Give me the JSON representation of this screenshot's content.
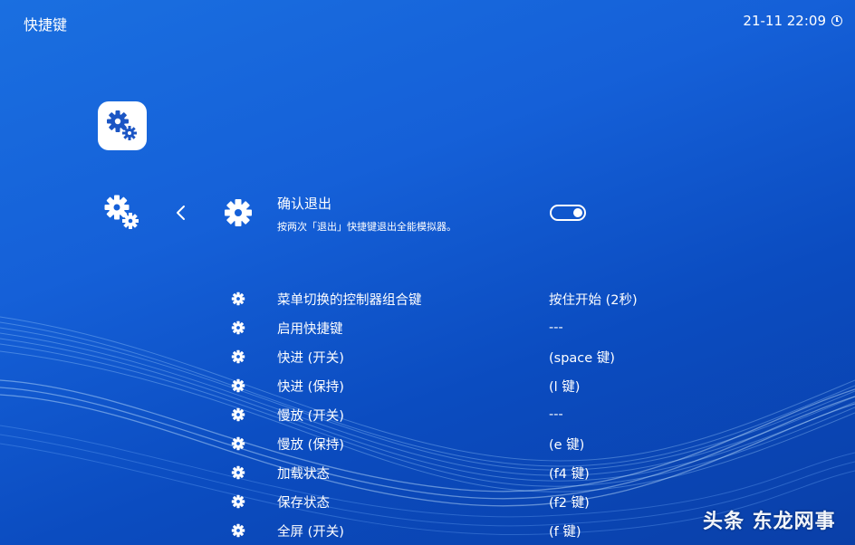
{
  "header": {
    "title": "快捷键",
    "clock": "21-11 22:09"
  },
  "highlight": {
    "title": "确认退出",
    "description": "按两次「退出」快捷键退出全能模拟器。",
    "toggle_on": true
  },
  "items": [
    {
      "label": "菜单切换的控制器组合键",
      "value": "按住开始 (2秒)"
    },
    {
      "label": "启用快捷键",
      "value": "---"
    },
    {
      "label": "快进 (开关)",
      "value": "(space 键)"
    },
    {
      "label": "快进 (保持)",
      "value": "(l 键)"
    },
    {
      "label": "慢放 (开关)",
      "value": "---"
    },
    {
      "label": "慢放 (保持)",
      "value": "(e 键)"
    },
    {
      "label": "加载状态",
      "value": "(f4 键)"
    },
    {
      "label": "保存状态",
      "value": "(f2 键)"
    },
    {
      "label": "全屏 (开关)",
      "value": "(f 键)"
    }
  ],
  "watermark": "头条 东龙网事",
  "colors": {
    "background_top": "#1a6fe0",
    "background_bottom": "#0a3fa8",
    "icon_fg": "#1b55c4"
  },
  "icons": {
    "app": "gears-icon",
    "side": "gears-icon",
    "back": "chevron-left-icon",
    "item": "gear-icon",
    "clock": "clock-icon"
  }
}
